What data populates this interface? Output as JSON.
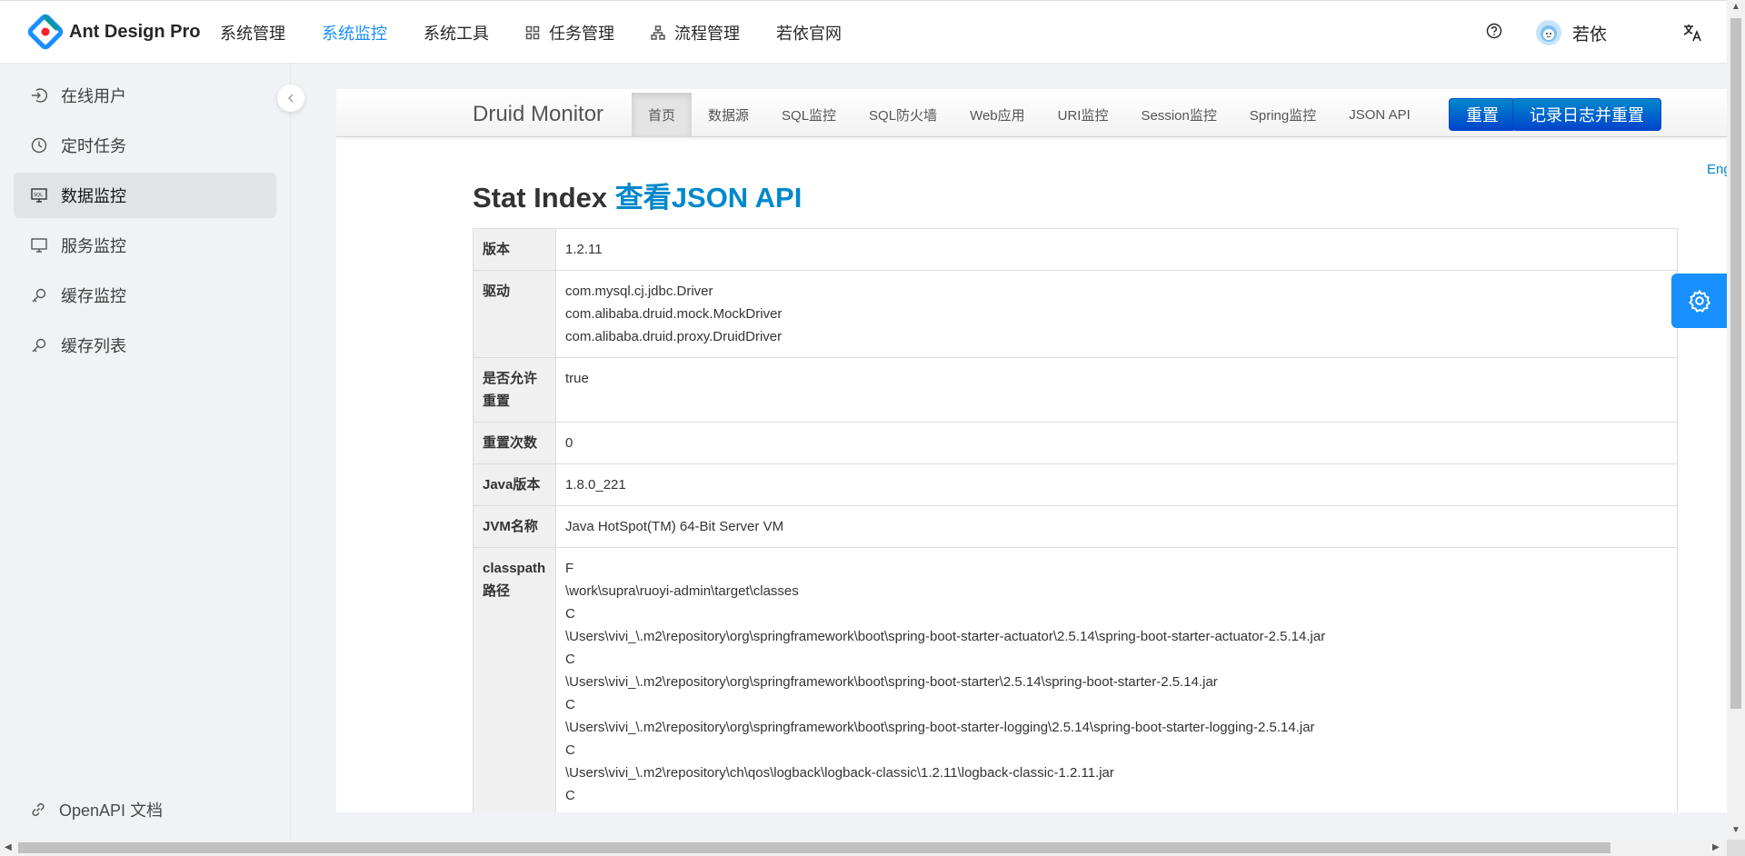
{
  "header": {
    "brand": "Ant Design Pro",
    "nav": [
      {
        "label": "系统管理"
      },
      {
        "label": "系统监控"
      },
      {
        "label": "系统工具"
      },
      {
        "label": "任务管理"
      },
      {
        "label": "流程管理"
      },
      {
        "label": "若依官网"
      }
    ],
    "active_nav": "系统监控",
    "user_name": "若依",
    "accent": "#1890ff"
  },
  "sidebar": {
    "items": [
      {
        "label": "在线用户",
        "icon": "login-icon"
      },
      {
        "label": "定时任务",
        "icon": "clock-icon"
      },
      {
        "label": "数据监控",
        "icon": "sql-monitor-icon"
      },
      {
        "label": "服务监控",
        "icon": "desktop-icon"
      },
      {
        "label": "缓存监控",
        "icon": "key-icon"
      },
      {
        "label": "缓存列表",
        "icon": "key-icon"
      }
    ],
    "selected": "数据监控",
    "footer": "OpenAPI 文档"
  },
  "druid": {
    "brand": "Druid Monitor",
    "tabs": [
      "首页",
      "数据源",
      "SQL监控",
      "SQL防火墙",
      "Web应用",
      "URI监控",
      "Session监控",
      "Spring监控",
      "JSON API"
    ],
    "active_tab": "首页",
    "reset_button": "重置",
    "log_reset_button": "记录日志并重置",
    "lang_link": "Eng",
    "title_prefix": "Stat Index",
    "title_link": "查看JSON API",
    "rows": [
      {
        "key": "版本",
        "lines": [
          "1.2.11"
        ]
      },
      {
        "key": "驱动",
        "lines": [
          "com.mysql.cj.jdbc.Driver",
          "com.alibaba.druid.mock.MockDriver",
          "com.alibaba.druid.proxy.DruidDriver"
        ]
      },
      {
        "key": "是否允许重置",
        "lines": [
          "true",
          ""
        ]
      },
      {
        "key": "重置次数",
        "lines": [
          "0"
        ]
      },
      {
        "key": "Java版本",
        "lines": [
          "1.8.0_221"
        ]
      },
      {
        "key": "JVM名称",
        "lines": [
          "Java HotSpot(TM) 64-Bit Server VM"
        ]
      },
      {
        "key": "classpath路径",
        "lines": [
          "F",
          "\\work\\supra\\ruoyi-admin\\target\\classes",
          "C",
          "\\Users\\vivi_\\.m2\\repository\\org\\springframework\\boot\\spring-boot-starter-actuator\\2.5.14\\spring-boot-starter-actuator-2.5.14.jar",
          "C",
          "\\Users\\vivi_\\.m2\\repository\\org\\springframework\\boot\\spring-boot-starter\\2.5.14\\spring-boot-starter-2.5.14.jar",
          "C",
          "\\Users\\vivi_\\.m2\\repository\\org\\springframework\\boot\\spring-boot-starter-logging\\2.5.14\\spring-boot-starter-logging-2.5.14.jar",
          "C",
          "\\Users\\vivi_\\.m2\\repository\\ch\\qos\\logback\\logback-classic\\1.2.11\\logback-classic-1.2.11.jar",
          "C"
        ]
      }
    ]
  }
}
